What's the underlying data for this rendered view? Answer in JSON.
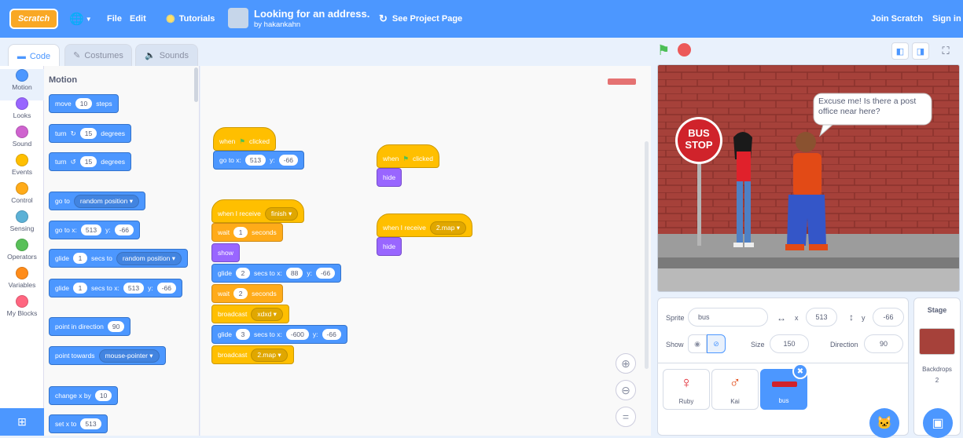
{
  "menubar": {
    "logo": "Scratch",
    "file": "File",
    "edit": "Edit",
    "tutorials": "Tutorials",
    "project_title": "Looking for an address.",
    "project_author": "by hakankahn",
    "see_project_page": "See Project Page",
    "join": "Join Scratch",
    "sign_in": "Sign in"
  },
  "tabs": {
    "code": "Code",
    "costumes": "Costumes",
    "sounds": "Sounds"
  },
  "categories": [
    "Motion",
    "Looks",
    "Sound",
    "Events",
    "Control",
    "Sensing",
    "Operators",
    "Variables",
    "My Blocks"
  ],
  "category_colors": [
    "#4c97ff",
    "#9966ff",
    "#cf63cf",
    "#ffbf00",
    "#ffab19",
    "#5cb1d6",
    "#59c059",
    "#ff8c1a",
    "#ff6680"
  ],
  "palette": {
    "heading": "Motion",
    "move": {
      "label": "move",
      "value": "10",
      "suffix": "steps"
    },
    "turn_right": {
      "label": "turn",
      "value": "15",
      "suffix": "degrees"
    },
    "turn_left": {
      "label": "turn",
      "value": "15",
      "suffix": "degrees"
    },
    "goto": {
      "label": "go to",
      "option": "random position"
    },
    "goto_xy": {
      "label": "go to x:",
      "x": "513",
      "ylabel": "y:",
      "y": "-66"
    },
    "glide": {
      "label": "glide",
      "value": "1",
      "mid": "secs to",
      "option": "random position"
    },
    "glide_xy": {
      "label": "glide",
      "value": "1",
      "mid": "secs to x:",
      "x": "513",
      "ylabel": "y:",
      "y": "-66"
    },
    "point_dir": {
      "label": "point in direction",
      "value": "90"
    },
    "point_towards": {
      "label": "point towards",
      "option": "mouse-pointer"
    },
    "change_x": {
      "label": "change x by",
      "value": "10"
    },
    "set_x": {
      "label": "set x to",
      "value": "513"
    }
  },
  "scripts": {
    "s1": {
      "when": "when",
      "clicked": "clicked",
      "goto": "go to x:",
      "x": "513",
      "ylabel": "y:",
      "y": "-66"
    },
    "s2": {
      "when": "when",
      "clicked": "clicked",
      "hide": "hide"
    },
    "s3": {
      "receive": "when I receive",
      "receive_msg": "finish",
      "wait1": "wait",
      "wait1_val": "1",
      "wait1_unit": "seconds",
      "show": "show",
      "glide1": "glide",
      "glide1_val": "2",
      "glide1_mid": "secs to x:",
      "glide1_x": "88",
      "glide1_ylabel": "y:",
      "glide1_y": "-66",
      "wait2": "wait",
      "wait2_val": "2",
      "wait2_unit": "seconds",
      "bc1": "broadcast",
      "bc1_msg": "xdxd",
      "glide2": "glide",
      "glide2_val": "3",
      "glide2_mid": "secs to x:",
      "glide2_x": "-600",
      "glide2_ylabel": "y:",
      "glide2_y": "-66",
      "bc2": "broadcast",
      "bc2_msg": "2.map"
    },
    "s4": {
      "receive": "when I receive",
      "receive_msg": "2.map",
      "hide": "hide"
    }
  },
  "stage": {
    "sign_line1": "BUS",
    "sign_line2": "STOP",
    "speech": "Excuse me! Is there a post office near here?"
  },
  "sprite_info": {
    "sprite_label": "Sprite",
    "sprite_name": "bus",
    "x_label": "x",
    "x": "513",
    "y_label": "y",
    "y": "-66",
    "show_label": "Show",
    "size_label": "Size",
    "size": "150",
    "direction_label": "Direction",
    "direction": "90"
  },
  "sprites": [
    "Ruby",
    "Kai",
    "bus"
  ],
  "stage_pane": {
    "title": "Stage",
    "backdrops_label": "Backdrops",
    "backdrops_count": "2"
  }
}
